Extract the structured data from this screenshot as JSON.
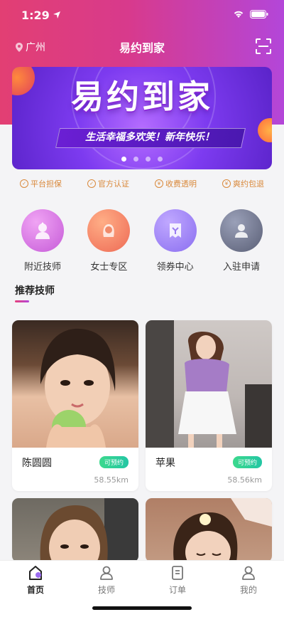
{
  "status_bar": {
    "time": "1:29"
  },
  "nav": {
    "location": "广州",
    "title": "易约到家"
  },
  "banner": {
    "title": "易约到家",
    "subtitle": "生活幸福多欢笑！新年快乐！",
    "total_slides": 4,
    "active_slide": 1
  },
  "guarantees": [
    {
      "label": "平台担保",
      "icon": "shield-icon"
    },
    {
      "label": "官方认证",
      "icon": "check-circle-icon"
    },
    {
      "label": "收费透明",
      "icon": "coin-icon"
    },
    {
      "label": "爽约包退",
      "icon": "refund-icon"
    }
  ],
  "categories": [
    {
      "label": "附近技师",
      "icon": "nearby-technician-icon",
      "color": "#d86fe0"
    },
    {
      "label": "女士专区",
      "icon": "ladies-zone-icon",
      "color": "#f07a5a"
    },
    {
      "label": "领券中心",
      "icon": "coupon-icon",
      "color": "#9a7cf0"
    },
    {
      "label": "入驻申请",
      "icon": "apply-icon",
      "color": "#6a6f86"
    }
  ],
  "section": {
    "title": "推荐技师"
  },
  "technicians": [
    {
      "name": "陈圆圆",
      "badge": "可预约",
      "distance": "58.55km"
    },
    {
      "name": "苹果",
      "badge": "可预约",
      "distance": "58.56km"
    },
    {
      "name": "",
      "badge": "",
      "distance": ""
    },
    {
      "name": "",
      "badge": "",
      "distance": ""
    }
  ],
  "tabs": [
    {
      "label": "首页",
      "icon": "home-icon",
      "active": true
    },
    {
      "label": "技师",
      "icon": "technician-icon",
      "active": false
    },
    {
      "label": "订单",
      "icon": "order-icon",
      "active": false
    },
    {
      "label": "我的",
      "icon": "profile-icon",
      "active": false
    }
  ],
  "colors": {
    "header_start": "#e23f73",
    "header_end": "#b346d9",
    "guarantee_text": "#d9883a",
    "badge_green": "#3cd98d"
  }
}
